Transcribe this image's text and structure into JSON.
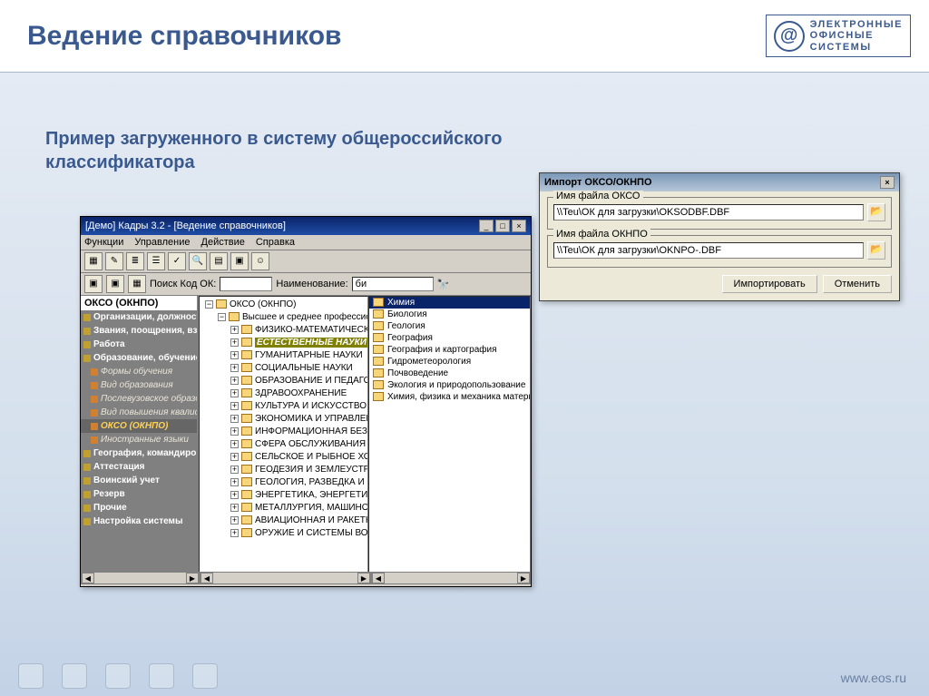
{
  "slide": {
    "title": "Ведение справочников",
    "subtitle": "Пример загруженного в систему общероссийского классификатора",
    "footer_url": "www.eos.ru",
    "logo_lines": [
      "ЭЛЕКТРОННЫЕ",
      "ОФИСНЫЕ",
      "СИСТЕМЫ"
    ]
  },
  "app": {
    "title": "[Демо] Кадры 3.2 - [Ведение справочников]",
    "menu": [
      "Функции",
      "Управление",
      "Действие",
      "Справка"
    ],
    "search_label": "Поиск Код ОК:",
    "name_label": "Наименование:",
    "name_value": "би",
    "nav_header": "ОКСО (ОКНПО)",
    "nav": [
      {
        "t": "Организации, должности",
        "c": "bold"
      },
      {
        "t": "Звания, поощрения, взыска",
        "c": "bold"
      },
      {
        "t": "Работа",
        "c": "bold"
      },
      {
        "t": "Образование, обучение",
        "c": "bold"
      },
      {
        "t": "Формы обучения",
        "c": "sub"
      },
      {
        "t": "Вид образования",
        "c": "sub"
      },
      {
        "t": "Послевузовское образо",
        "c": "sub"
      },
      {
        "t": "Вид повышения квалифи",
        "c": "sub"
      },
      {
        "t": "ОКСО (ОКНПО)",
        "c": "sub sel"
      },
      {
        "t": "Иностранные языки",
        "c": "sub"
      },
      {
        "t": "География, командировки",
        "c": "bold"
      },
      {
        "t": "Аттестация",
        "c": "bold"
      },
      {
        "t": "Воинский учет",
        "c": "bold"
      },
      {
        "t": "Резерв",
        "c": "bold"
      },
      {
        "t": "Прочие",
        "c": "bold"
      },
      {
        "t": "Настройка системы",
        "c": "bold"
      }
    ],
    "tree_root": "ОКСО (ОКНПО)",
    "tree_l2": "Высшее и среднее профессиональ",
    "tree_l3": [
      "ФИЗИКО-МАТЕМАТИЧЕСКИЕ НАУ",
      "ЕСТЕСТВЕННЫЕ НАУКИ",
      "ГУМАНИТАРНЫЕ НАУКИ",
      "СОЦИАЛЬНЫЕ НАУКИ",
      "ОБРАЗОВАНИЕ И ПЕДАГОГИКА",
      "ЗДРАВООХРАНЕНИЕ",
      "КУЛЬТУРА И ИСКУССТВО",
      "ЭКОНОМИКА И УПРАВЛЕНИЕ",
      "ИНФОРМАЦИОННАЯ БЕЗОПАСН",
      "СФЕРА ОБСЛУЖИВАНИЯ",
      "СЕЛЬСКОЕ И РЫБНОЕ ХОЗЯЙСТВ",
      "ГЕОДЕЗИЯ И ЗЕМЛЕУСТРОЙСТВ",
      "ГЕОЛОГИЯ, РАЗВЕДКА И РАЗРА",
      "ЭНЕРГЕТИКА, ЭНЕРГЕТИЧЕСКОЕ",
      "МЕТАЛЛУРГИЯ, МАШИНОСТРОЕ",
      "АВИАЦИОННАЯ И РАКЕТНО-КОС",
      "ОРУЖИЕ И СИСТЕМЫ ВООРУЖЕ"
    ],
    "tree_sel_index": 1,
    "right": [
      "Химия",
      "Биология",
      "Геология",
      "География",
      "География и картография",
      "Гидрометеорология",
      "Почвоведение",
      "Экология и природопользование",
      "Химия, физика и механика материалов"
    ],
    "right_sel_index": 0
  },
  "dlg": {
    "title": "Импорт ОКСО/ОКНПО",
    "g1_label": "Имя файла ОКСО",
    "g1_value": "\\\\Teu\\ОК для загрузки\\OKSODBF.DBF",
    "g2_label": "Имя файла ОКНПО",
    "g2_value": "\\\\Teu\\ОК для загрузки\\OKNPO-.DBF",
    "btn_import": "Импортировать",
    "btn_cancel": "Отменить"
  }
}
